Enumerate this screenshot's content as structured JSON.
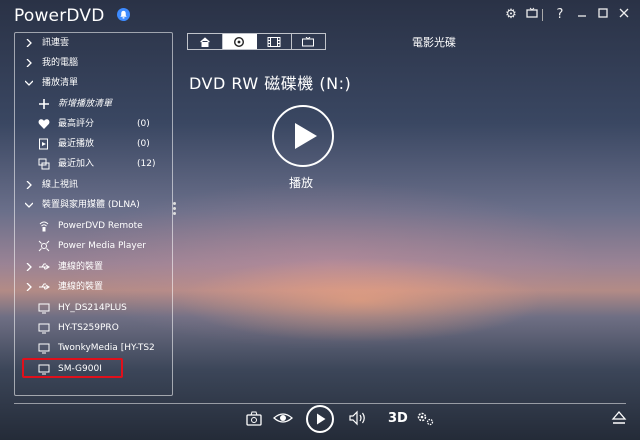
{
  "app": {
    "title": "PowerDVD",
    "notification_badge": "n"
  },
  "sidebar": {
    "items": [
      {
        "label": "訊連雲",
        "expand": "collapsed"
      },
      {
        "label": "我的電腦",
        "expand": "collapsed"
      },
      {
        "label": "播放清單",
        "expand": "expanded"
      },
      {
        "label": "新增播放清單",
        "icon": "plus-icon"
      },
      {
        "label": "最高評分",
        "count": "(0)",
        "icon": "heart-icon"
      },
      {
        "label": "最近播放",
        "count": "(0)",
        "icon": "recent-play-icon"
      },
      {
        "label": "最近加入",
        "count": "(12)",
        "icon": "recent-add-icon"
      },
      {
        "label": "線上視訊",
        "expand": "collapsed"
      },
      {
        "label": "裝置與家用媒體 (DLNA)",
        "expand": "expanded"
      },
      {
        "label": "PowerDVD Remote",
        "icon": "remote-icon"
      },
      {
        "label": "Power Media Player",
        "icon": "media-player-icon"
      },
      {
        "label": "連線的裝置",
        "icon": "usb-icon"
      },
      {
        "label": "連線的裝置",
        "icon": "usb-icon"
      },
      {
        "label": "HY_DS214PLUS",
        "icon": "monitor-icon"
      },
      {
        "label": "HY-TS259PRO",
        "icon": "monitor-icon"
      },
      {
        "label": "TwonkyMedia [HY-TS2",
        "icon": "monitor-icon"
      },
      {
        "label": "SM-G900I",
        "icon": "monitor-icon",
        "highlighted": true
      }
    ]
  },
  "main": {
    "section_title": "電影光碟",
    "disc_title": "DVD RW 磁碟機 (N:)",
    "play_label": "播放",
    "tabs": [
      "home",
      "disc",
      "film",
      "tv"
    ],
    "active_tab": "disc"
  },
  "controls": {
    "three_d_label": "3D"
  },
  "colors": {
    "highlight": "#e0101b",
    "accent": "#3d8bff"
  }
}
